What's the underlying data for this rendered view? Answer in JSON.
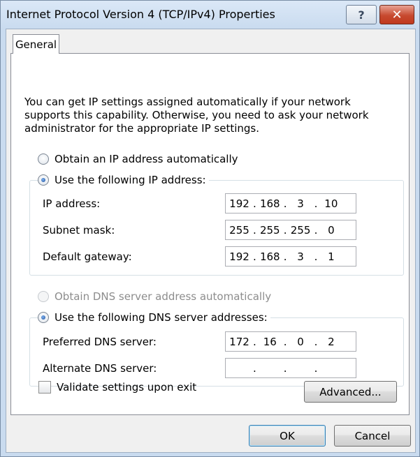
{
  "window": {
    "title": "Internet Protocol Version 4 (TCP/IPv4) Properties",
    "help_icon": "?",
    "close_icon": "✕"
  },
  "tabs": [
    {
      "label": "General",
      "active": true
    }
  ],
  "description": "You can get IP settings assigned automatically if your network supports this capability. Otherwise, you need to ask your network administrator for the appropriate IP settings.",
  "ip": {
    "auto_label": "Obtain an IP address automatically",
    "auto_selected": false,
    "manual_label": "Use the following IP address:",
    "manual_selected": true,
    "fields": [
      {
        "label": "IP address:",
        "octets": [
          "192",
          "168",
          "3",
          "10"
        ]
      },
      {
        "label": "Subnet mask:",
        "octets": [
          "255",
          "255",
          "255",
          "0"
        ]
      },
      {
        "label": "Default gateway:",
        "octets": [
          "192",
          "168",
          "3",
          "1"
        ]
      }
    ]
  },
  "dns": {
    "auto_label": "Obtain DNS server address automatically",
    "auto_selected": false,
    "auto_disabled": true,
    "manual_label": "Use the following DNS server addresses:",
    "manual_selected": true,
    "fields": [
      {
        "label": "Preferred DNS server:",
        "octets": [
          "172",
          "16",
          "0",
          "2"
        ]
      },
      {
        "label": "Alternate DNS server:",
        "octets": [
          "",
          "",
          "",
          ""
        ]
      }
    ]
  },
  "validate": {
    "label": "Validate settings upon exit",
    "checked": false
  },
  "buttons": {
    "advanced": "Advanced...",
    "ok": "OK",
    "cancel": "Cancel"
  },
  "colors": {
    "accent": "#3c7fb1",
    "close": "#c74a2f"
  }
}
